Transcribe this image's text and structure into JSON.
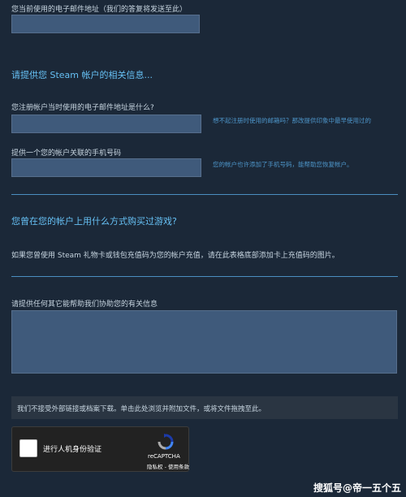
{
  "email_section": {
    "label": "您当前使用的电子邮件地址（我们的答复将发送至此）",
    "value": ""
  },
  "account_section": {
    "heading": "请提供您 Steam 帐户的相关信息...",
    "registered_email_label": "您注册帐户当时使用的电子邮件地址是什么?",
    "registered_email_value": "",
    "registered_email_hint": "想不起注册时使用的邮箱吗？那改提供印象中最早使用过的",
    "phone_label": "提供一个您的帐户关联的手机号码",
    "phone_value": "",
    "phone_hint": "您的帐户也许添加了手机号码，能帮助您恢复帐户。"
  },
  "purchase_section": {
    "heading": "您曾在您的帐户上用什么方式购买过游戏?",
    "text": "如果您曾使用 Steam 礼物卡或钱包充值码为您的帐户充值，请在此表格底部添加卡上充值码的图片。"
  },
  "extra_info": {
    "label": "请提供任何其它能帮助我们协助您的有关信息",
    "value": ""
  },
  "attachment": {
    "text": "我们不接受外部链接或档案下载。单击此处浏览并附加文件，或将文件拖拽至此。"
  },
  "captcha": {
    "label": "进行人机身份验证",
    "brand": "reCAPTCHA",
    "links": "隐私权 - 使用条款"
  },
  "watermark": {
    "text": "搜狐号@帝一五个五"
  },
  "colors": {
    "background": "#1b2838",
    "accent": "#66c0f4",
    "field": "#3f5a7b",
    "hint": "#4d95c9"
  }
}
